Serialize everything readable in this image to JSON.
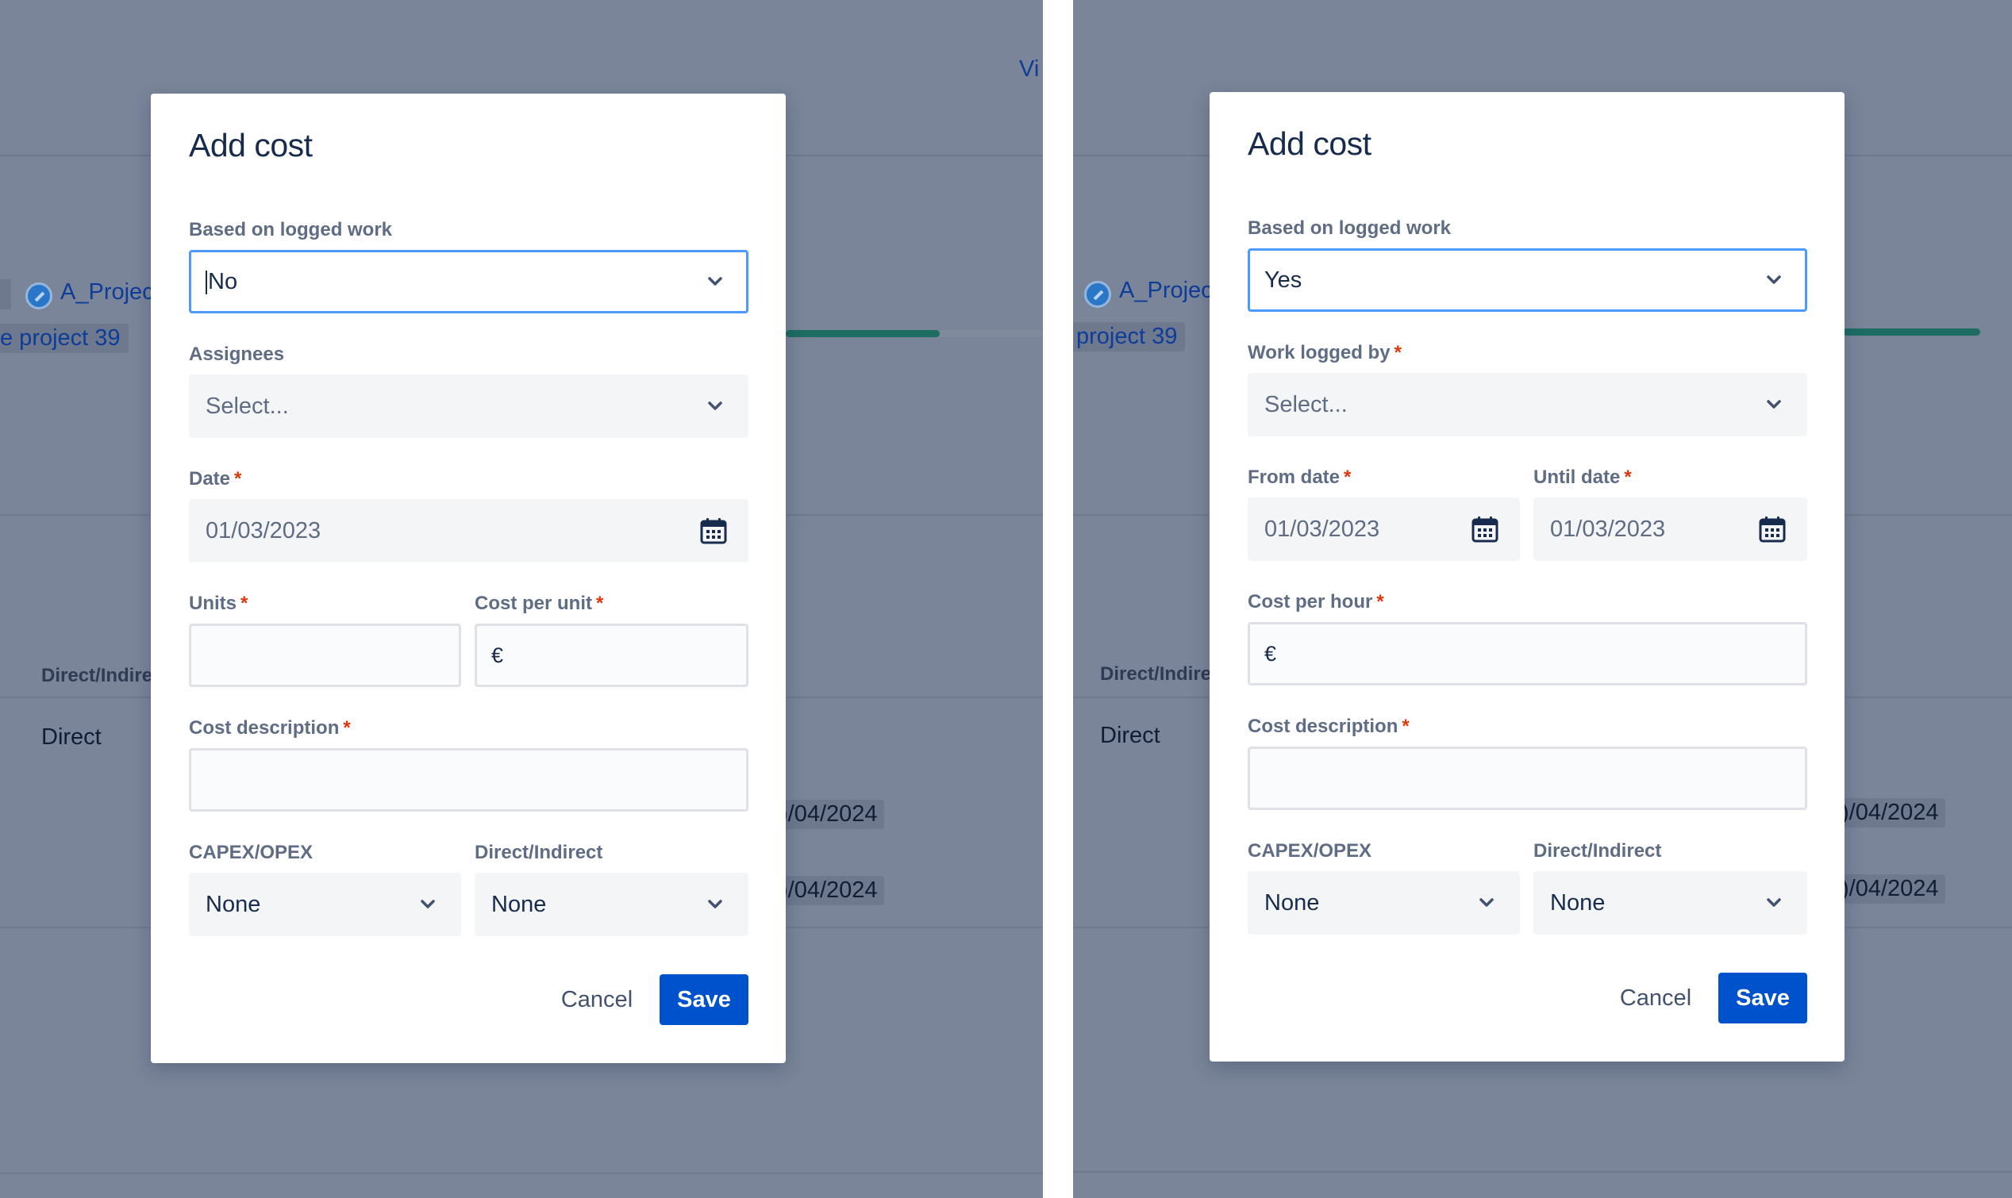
{
  "background": {
    "view_link": "Vi",
    "project_name": "A_Projec",
    "project_tag_left": "e project 39",
    "project_tag_right": "project 39",
    "column_header": "Direct/Indire",
    "row_type": "Direct",
    "date_1": ")/04/2024",
    "date_2": ")/04/2024",
    "progress_left": 0.6,
    "progress_right": 1.0
  },
  "left_dialog": {
    "title": "Add cost",
    "logged_work": {
      "label": "Based on logged work",
      "value": "No"
    },
    "assignees": {
      "label": "Assignees",
      "placeholder": "Select..."
    },
    "date": {
      "label": "Date",
      "required": "*",
      "value": "01/03/2023"
    },
    "units": {
      "label": "Units",
      "required": "*",
      "value": ""
    },
    "cost_per_unit": {
      "label": "Cost per unit",
      "required": "*",
      "currency": "€",
      "value": ""
    },
    "cost_description": {
      "label": "Cost description",
      "required": "*",
      "value": ""
    },
    "capex_opex": {
      "label": "CAPEX/OPEX",
      "value": "None"
    },
    "direct_indirect": {
      "label": "Direct/Indirect",
      "value": "None"
    },
    "cancel_label": "Cancel",
    "save_label": "Save"
  },
  "right_dialog": {
    "title": "Add cost",
    "logged_work": {
      "label": "Based on logged work",
      "value": "Yes"
    },
    "work_logged_by": {
      "label": "Work logged by",
      "required": "*",
      "placeholder": "Select..."
    },
    "from_date": {
      "label": "From date",
      "required": "*",
      "value": "01/03/2023"
    },
    "until_date": {
      "label": "Until date",
      "required": "*",
      "value": "01/03/2023"
    },
    "cost_per_hour": {
      "label": "Cost per hour",
      "required": "*",
      "currency": "€",
      "value": ""
    },
    "cost_description": {
      "label": "Cost description",
      "required": "*",
      "value": ""
    },
    "capex_opex": {
      "label": "CAPEX/OPEX",
      "value": "None"
    },
    "direct_indirect": {
      "label": "Direct/Indirect",
      "value": "None"
    },
    "cancel_label": "Cancel",
    "save_label": "Save"
  },
  "icons": {
    "chevron": "chevron-down-icon",
    "calendar": "calendar-icon",
    "avatar": "project-avatar-icon"
  }
}
